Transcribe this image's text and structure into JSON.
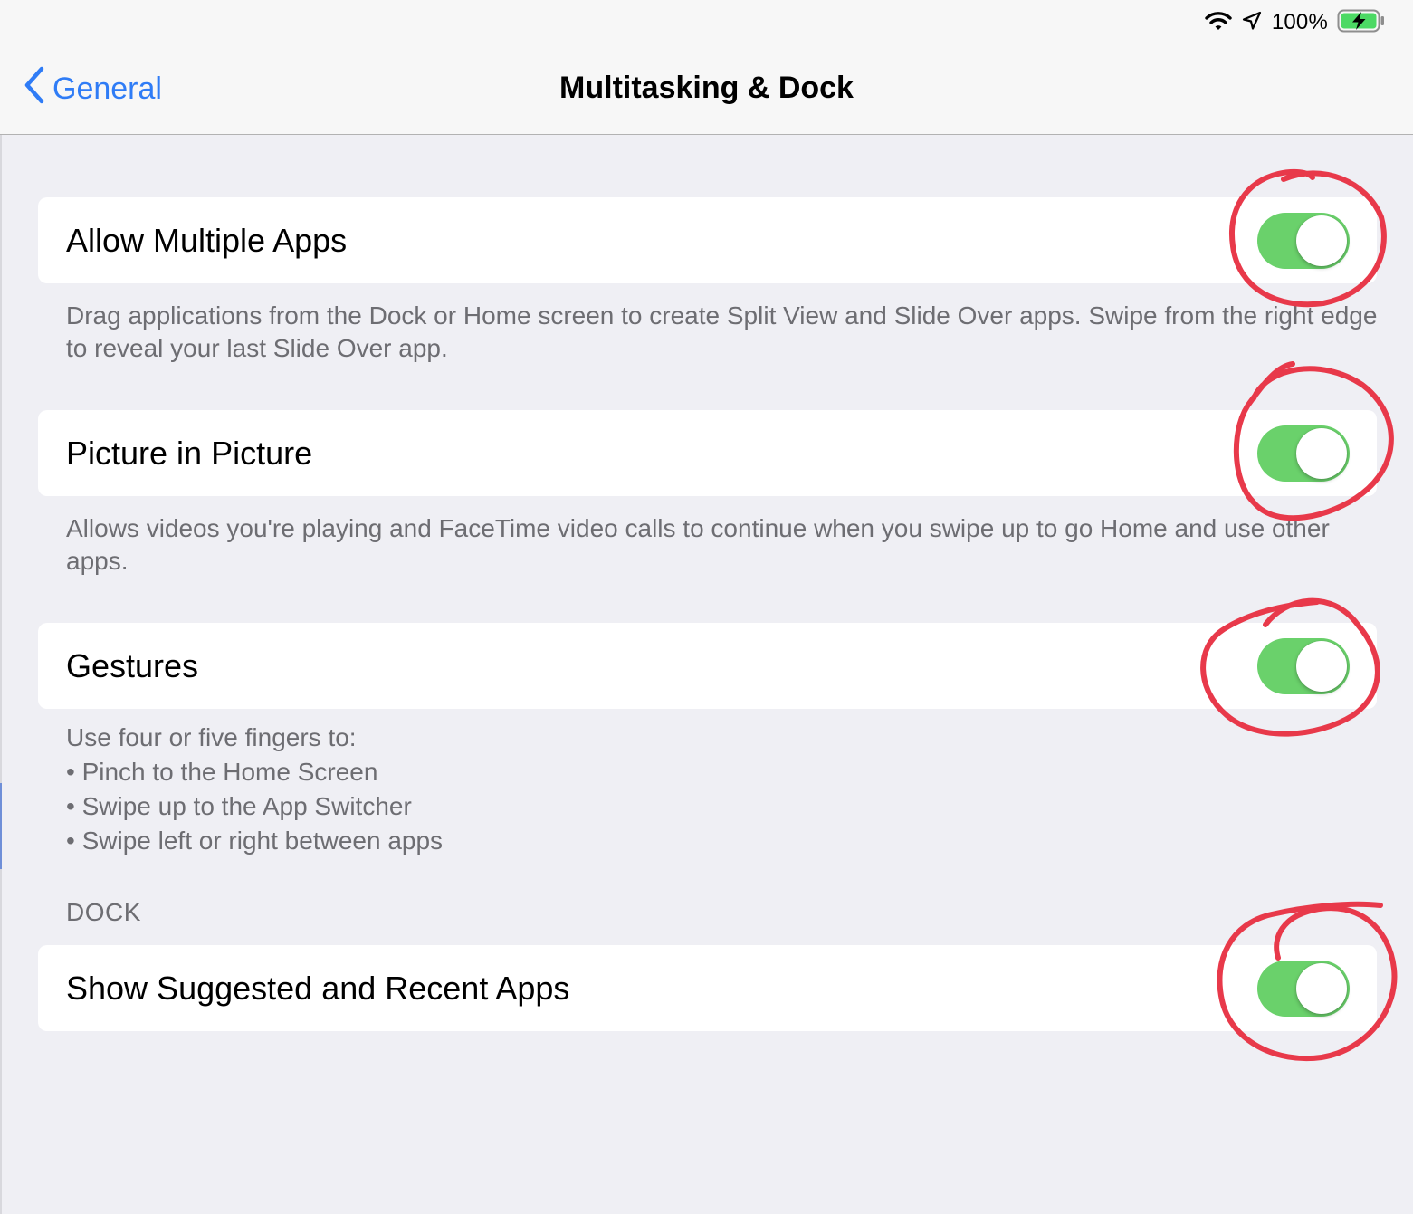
{
  "status_bar": {
    "battery_percent": "100%",
    "icons": [
      "wifi-icon",
      "location-arrow-icon",
      "battery-charging-icon"
    ]
  },
  "nav": {
    "back_label": "General",
    "title": "Multitasking & Dock"
  },
  "settings": {
    "allow_multiple_apps": {
      "label": "Allow Multiple Apps",
      "enabled": true,
      "footer": "Drag applications from the Dock or Home screen to create Split View and Slide Over apps. Swipe from the right edge to reveal your last Slide Over app."
    },
    "picture_in_picture": {
      "label": "Picture in Picture",
      "enabled": true,
      "footer": "Allows videos you're playing and FaceTime video calls to continue when you swipe up to go Home and use other apps."
    },
    "gestures": {
      "label": "Gestures",
      "enabled": true,
      "footer_lines": [
        "Use four or five fingers to:",
        "• Pinch to the Home Screen",
        "• Swipe up to the App Switcher",
        "• Swipe left or right between apps"
      ]
    },
    "dock_section_header": "DOCK",
    "show_suggested_and_recent_apps": {
      "label": "Show Suggested and Recent Apps",
      "enabled": true
    }
  },
  "colors": {
    "accent": "#2f7cf6",
    "toggle_on": "#6ad16b",
    "annotation": "#e8394a",
    "background": "#efeff4"
  }
}
